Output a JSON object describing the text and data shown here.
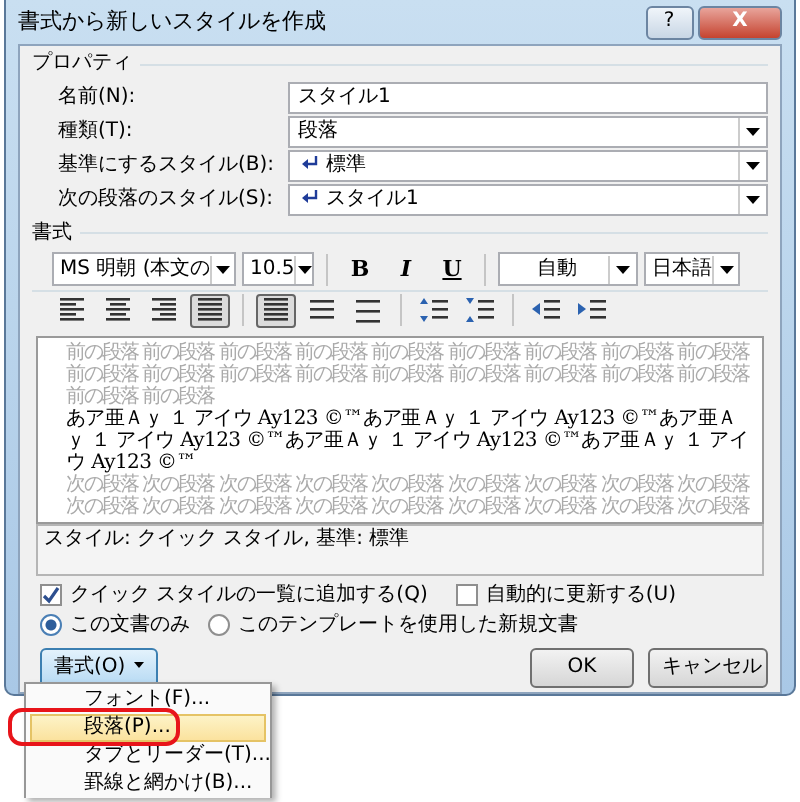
{
  "window": {
    "title": "書式から新しいスタイルを作成",
    "buttons": [
      "?",
      "X"
    ]
  },
  "properties": {
    "heading": "プロパティ",
    "fields": [
      {
        "label": "名前(N):",
        "kind": "text",
        "value": "スタイル1"
      },
      {
        "label": "種類(T):",
        "kind": "select",
        "value": "段落"
      },
      {
        "label": "基準にするスタイル(B):",
        "kind": "select",
        "value": "標準",
        "para_mark": true
      },
      {
        "label": "次の段落のスタイル(S):",
        "kind": "select",
        "value": "スタイル1",
        "para_mark": true
      }
    ]
  },
  "format": {
    "heading": "書式",
    "font": "MS 明朝 (本文の",
    "size": "10.5",
    "bold": "B",
    "italic": "I",
    "underline": "U",
    "font_color": "自動",
    "language": "日本語",
    "paragraph_buttons": [
      {
        "kind": "align-left",
        "selected": false
      },
      {
        "kind": "align-center",
        "selected": false
      },
      {
        "kind": "align-right",
        "selected": false
      },
      {
        "kind": "justify",
        "selected": true
      },
      {
        "kind": "spacing-single",
        "selected": true
      },
      {
        "kind": "spacing-one-half",
        "selected": false
      },
      {
        "kind": "spacing-double",
        "selected": false
      },
      {
        "kind": "space-before",
        "selected": false
      },
      {
        "kind": "space-after",
        "selected": false
      },
      {
        "kind": "indent-decrease",
        "selected": false
      },
      {
        "kind": "indent-increase",
        "selected": false
      }
    ]
  },
  "preview": {
    "previous": [
      "前の段落 前の段落 前の段落 前の段落 前の段落 前の段落 前の段落 前の段落 前の段落",
      "前の段落 前の段落 前の段落 前の段落 前の段落 前の段落 前の段落 前の段落 前の段落",
      "前の段落 前の段落"
    ],
    "sample": "あア亜Ａｙ １ アイウ Ay123 ©™あア亜Ａｙ １ アイウ Ay123 ©™あア亜Ａｙ １ アイウ Ay123 ©™あア亜Ａｙ １ アイウ Ay123 ©™あア亜Ａｙ １ アイウ Ay123 ©™",
    "next": [
      "次の段落 次の段落 次の段落 次の段落 次の段落 次の段落 次の段落 次の段落 次の段落",
      "次の段落 次の段落 次の段落 次の段落 次の段落 次の段落 次の段落 次の段落 次の段落"
    ]
  },
  "description": "スタイル: クイック スタイル, 基準: 標準",
  "options": [
    {
      "kind": "checkbox",
      "label": "クイック スタイルの一覧に追加する(Q)",
      "checked": true
    },
    {
      "kind": "checkbox",
      "label": "自動的に更新する(U)",
      "checked": false
    }
  ],
  "scope": [
    {
      "label": "この文書のみ",
      "selected": true
    },
    {
      "label": "このテンプレートを使用した新規文書",
      "selected": false
    }
  ],
  "format_button": "書式(O)",
  "buttons": [
    "OK",
    "キャンセル"
  ],
  "menu": [
    {
      "label": "フォント(F)...",
      "highlighted": false,
      "circled": false
    },
    {
      "label": "段落(P)...",
      "highlighted": true,
      "circled": true
    },
    {
      "label": "タブとリーダー(T)...",
      "highlighted": false,
      "circled": false
    },
    {
      "label": "罫線と網かけ(B)...",
      "highlighted": false,
      "circled": false
    }
  ]
}
